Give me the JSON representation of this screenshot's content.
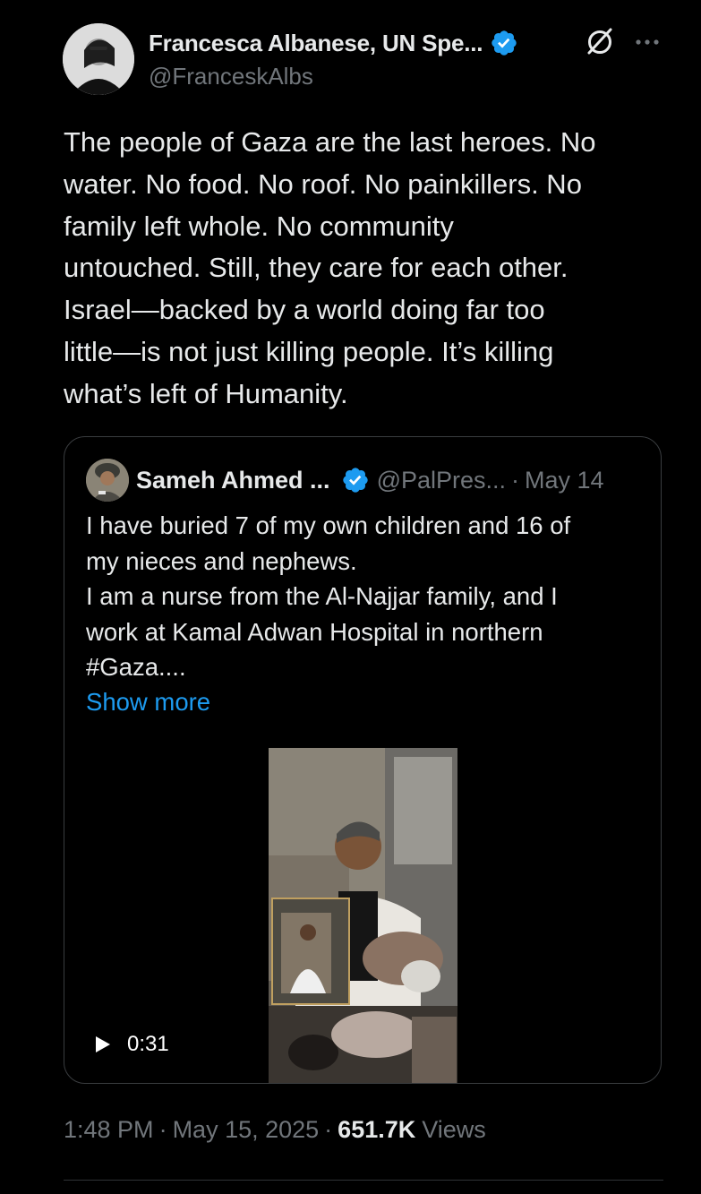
{
  "tweet": {
    "author": {
      "display_name": "Francesca Albanese, UN Spe...",
      "handle": "@FranceskAlbs",
      "verified": true
    },
    "text": "The people of Gaza are the last heroes. No\nwater. No food. No roof. No painkillers. No\nfamily left whole. No community\nuntouched. Still, they care for each other.\nIsrael—backed by a world doing far too\nlittle—is not just killing people. It’s killing\nwhat’s left of Humanity.",
    "timestamp": {
      "time": "1:48 PM",
      "separator": "·",
      "date": "May 15, 2025"
    },
    "views": {
      "count": "651.7K",
      "label": "Views"
    }
  },
  "quoted_tweet": {
    "author": {
      "display_name": "Sameh Ahmed ...",
      "handle": "@PalPres...",
      "verified": true
    },
    "separator": "·",
    "date": "May 14",
    "text": "I have buried 7 of my own children and 16 of\nmy nieces and nephews.\nI am a nurse from the Al-Najjar family, and I\nwork at Kamal Adwan Hospital in northern\n#Gaza....",
    "show_more_label": "Show more",
    "video": {
      "duration": "0:31"
    }
  },
  "colors": {
    "background": "#000000",
    "text_primary": "#e7e9ea",
    "text_secondary": "#71767b",
    "link": "#1d9bf0",
    "verified_badge": "#1d9bf0",
    "border": "#3a3d40"
  },
  "icons": {
    "verified": "verified-badge-icon",
    "grok": "grok-icon",
    "more": "more-options-icon",
    "play": "play-icon"
  }
}
